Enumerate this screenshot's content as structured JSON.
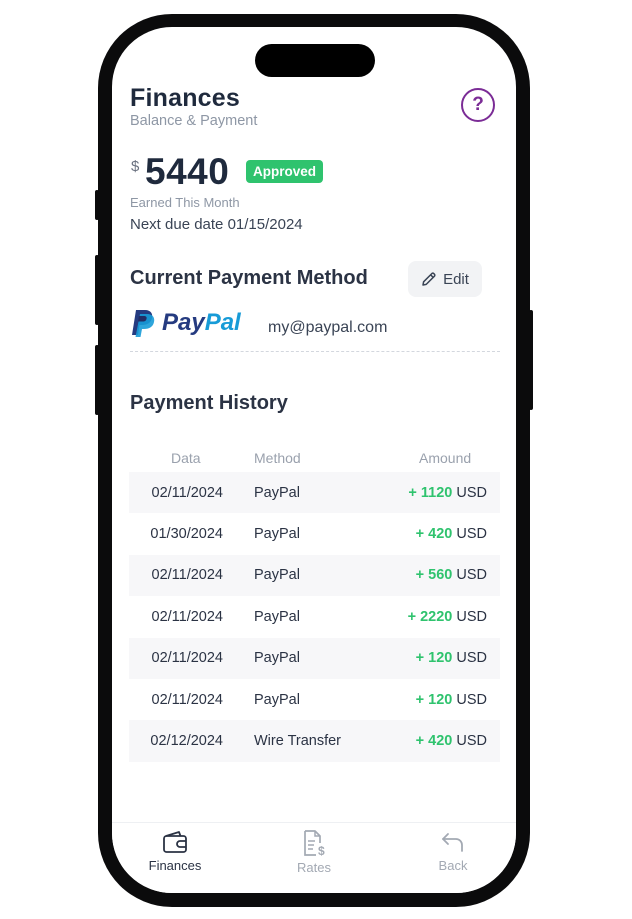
{
  "header": {
    "title": "Finances",
    "subtitle": "Balance & Payment",
    "help_icon": "question-circle-icon",
    "help_color": "#7b2c96"
  },
  "balance": {
    "currency_symbol": "$",
    "amount": "5440",
    "status_badge": "Approved",
    "status_color": "#2fc36e",
    "earned_label": "Earned This Month",
    "next_due": "Next due date 01/15/2024"
  },
  "payment_method": {
    "section_title": "Current Payment Method",
    "edit_label": "Edit",
    "edit_icon": "pencil-icon",
    "provider_logo": "paypal-logo",
    "provider_name_part1": "Pay",
    "provider_name_part2": "Pal",
    "email": "my@paypal.com"
  },
  "payment_history": {
    "section_title": "Payment History",
    "columns": [
      "Data",
      "Method",
      "Amound"
    ],
    "rows": [
      {
        "date": "02/11/2024",
        "method": "PayPal",
        "sign": "+",
        "amount": "1120",
        "currency": "USD"
      },
      {
        "date": "01/30/2024",
        "method": "PayPal",
        "sign": "+",
        "amount": "420",
        "currency": "USD"
      },
      {
        "date": "02/11/2024",
        "method": "PayPal",
        "sign": "+",
        "amount": "560",
        "currency": "USD"
      },
      {
        "date": "02/11/2024",
        "method": "PayPal",
        "sign": "+",
        "amount": "2220",
        "currency": "USD"
      },
      {
        "date": "02/11/2024",
        "method": "PayPal",
        "sign": "+",
        "amount": "120",
        "currency": "USD"
      },
      {
        "date": "02/11/2024",
        "method": "PayPal",
        "sign": "+",
        "amount": "120",
        "currency": "USD"
      },
      {
        "date": "02/12/2024",
        "method": "Wire Transfer",
        "sign": "+",
        "amount": "420",
        "currency": "USD"
      }
    ]
  },
  "tabbar": {
    "tabs": [
      {
        "label": "Finances",
        "icon": "wallet-icon",
        "active": true
      },
      {
        "label": "Rates",
        "icon": "invoice-dollar-icon",
        "active": false
      },
      {
        "label": "Back",
        "icon": "back-arrow-icon",
        "active": false
      }
    ]
  }
}
